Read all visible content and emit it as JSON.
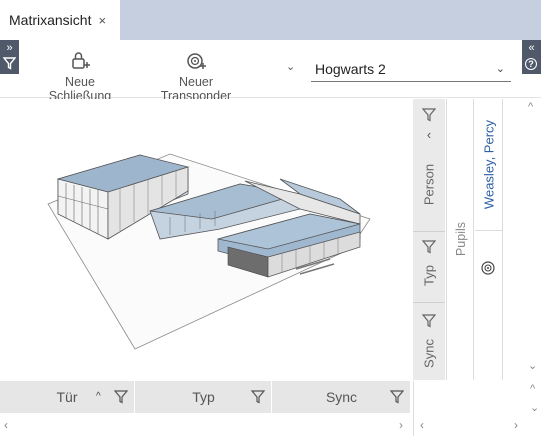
{
  "tab": {
    "title": "Matrixansicht",
    "close_glyph": "×"
  },
  "toolbar": {
    "new_lock_label": "Neue Schließung",
    "new_transponder_label": "Neuer Transponder",
    "expand_glyph": "⌄"
  },
  "project_select": {
    "value": "Hogwarts 2",
    "arrow": "⌄"
  },
  "side_strips": {
    "left_glyph": "»",
    "right_glyph": "«",
    "help_glyph": "?"
  },
  "filters": {
    "collapse_glyph": "‹",
    "person_label": "Person",
    "type_label": "Typ",
    "sync_label": "Sync"
  },
  "matrix": {
    "group_label": "Pupils",
    "person_name": "Weasley, Percy",
    "scroll_up": "^",
    "scroll_down": "⌄"
  },
  "columns": {
    "door": "Tür",
    "type": "Typ",
    "sync": "Sync",
    "sort_glyph": "^"
  },
  "hscroll": {
    "left": "‹",
    "right": "›"
  },
  "colors": {
    "tabbar_bg": "#c6cfe0",
    "strip_bg": "#50596a",
    "header_bg": "#e6e6e6",
    "filter_bg": "#eaeaea",
    "accent_blue": "#2e5fa3"
  },
  "illustration": {
    "subject": "3D isometric building model"
  }
}
